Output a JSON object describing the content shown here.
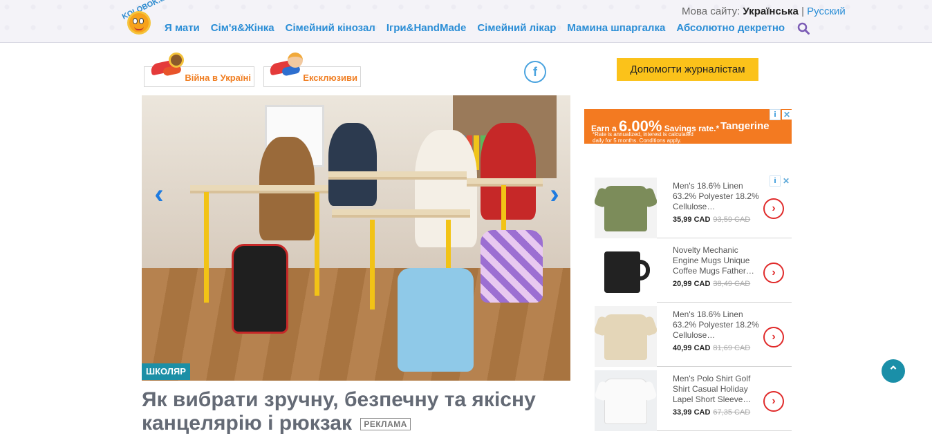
{
  "header": {
    "logo_text": "KOLOBOK.ua",
    "nav": [
      "Я мати",
      "Сім'я&Жінка",
      "Сімейний кінозал",
      "Ігри&HandMade",
      "Сімейний лікар",
      "Мамина шпаргалка",
      "Абсолютно декретно"
    ],
    "lang_label": "Мова сайту:",
    "lang_current": "Українська",
    "lang_separator": "|",
    "lang_alt": "Русский"
  },
  "hero_buttons": [
    {
      "label": "Війна в Україні"
    },
    {
      "label": "Ексклюзиви"
    }
  ],
  "social": {
    "facebook_glyph": "f"
  },
  "donate_label": "Допомогти журналістам",
  "article": {
    "category": "ШКОЛЯР",
    "title": "Як вибрати зручну, безпечну та якісну канцелярію і рюкзак",
    "ad_badge": "РЕКЛАМА"
  },
  "banner_ad": {
    "earn": "Earn a",
    "rate": "6.00%",
    "rate_suffix": "Savings rate.*",
    "note_line1": "*Rate is annualized, interest is calculated",
    "note_line2": "daily for 5 months. Conditions apply.",
    "brand": "Tangerine",
    "brand_color": "#f37a21"
  },
  "product_ads": [
    {
      "title": "Men's 18.6% Linen 63.2% Polyester 18.2% Cellulose…",
      "price": "35,99 CAD",
      "old_price": "93,59 CAD"
    },
    {
      "title": "Novelty Mechanic Engine Mugs Unique Coffee Mugs Father…",
      "price": "20,99 CAD",
      "old_price": "38,49 CAD"
    },
    {
      "title": "Men's 18.6% Linen 63.2% Polyester 18.2% Cellulose…",
      "price": "40,99 CAD",
      "old_price": "81,69 CAD"
    },
    {
      "title": "Men's Polo Shirt Golf Shirt Casual Holiday Lapel Short Sleeve…",
      "price": "33,99 CAD",
      "old_price": "67,35 CAD"
    }
  ],
  "colors": {
    "nav_link": "#2b8ed6",
    "accent_orange": "#f07e22",
    "donate_bg": "#fbc21a",
    "tag_bg": "#1c8fa6",
    "scroll_top_bg": "#1a8fa8"
  },
  "icons": {
    "search": "search-icon",
    "arrow_left": "chevron-left-icon",
    "arrow_right": "chevron-right-icon",
    "scroll_top": "chevron-up-icon"
  }
}
